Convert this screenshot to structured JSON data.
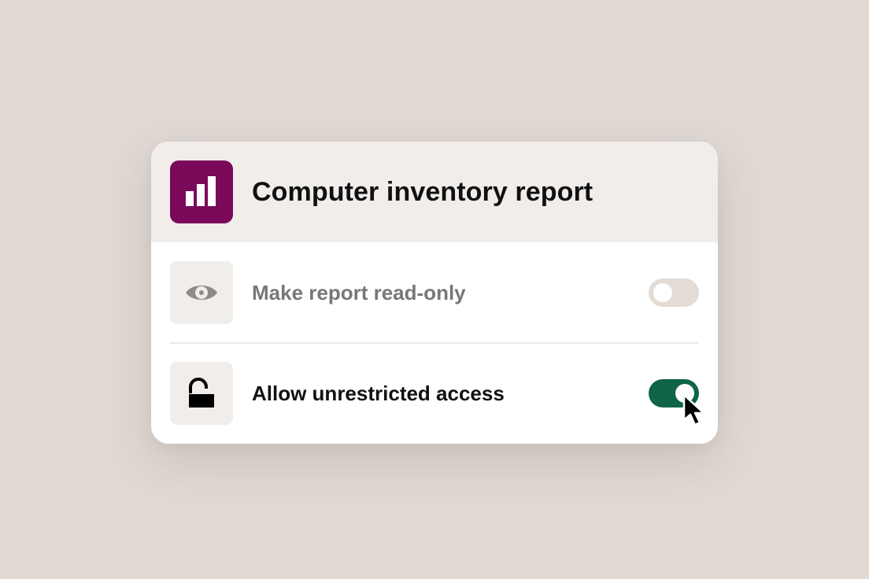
{
  "colors": {
    "background": "#e0d9d4",
    "app_icon_bg": "#7a0a59",
    "toggle_on": "#0f6448",
    "toggle_off": "#e3dcd6",
    "muted_text": "#797775",
    "primary_text": "#111111"
  },
  "header": {
    "icon": "bar-chart-icon",
    "title": "Computer inventory report"
  },
  "settings": [
    {
      "icon": "eye-icon",
      "label": "Make report read-only",
      "enabled": false,
      "disabled_appearance": true
    },
    {
      "icon": "unlocked-padlock-icon",
      "label": "Allow unrestricted access",
      "enabled": true,
      "disabled_appearance": false
    }
  ],
  "pointer": "mouse-pointer-icon"
}
